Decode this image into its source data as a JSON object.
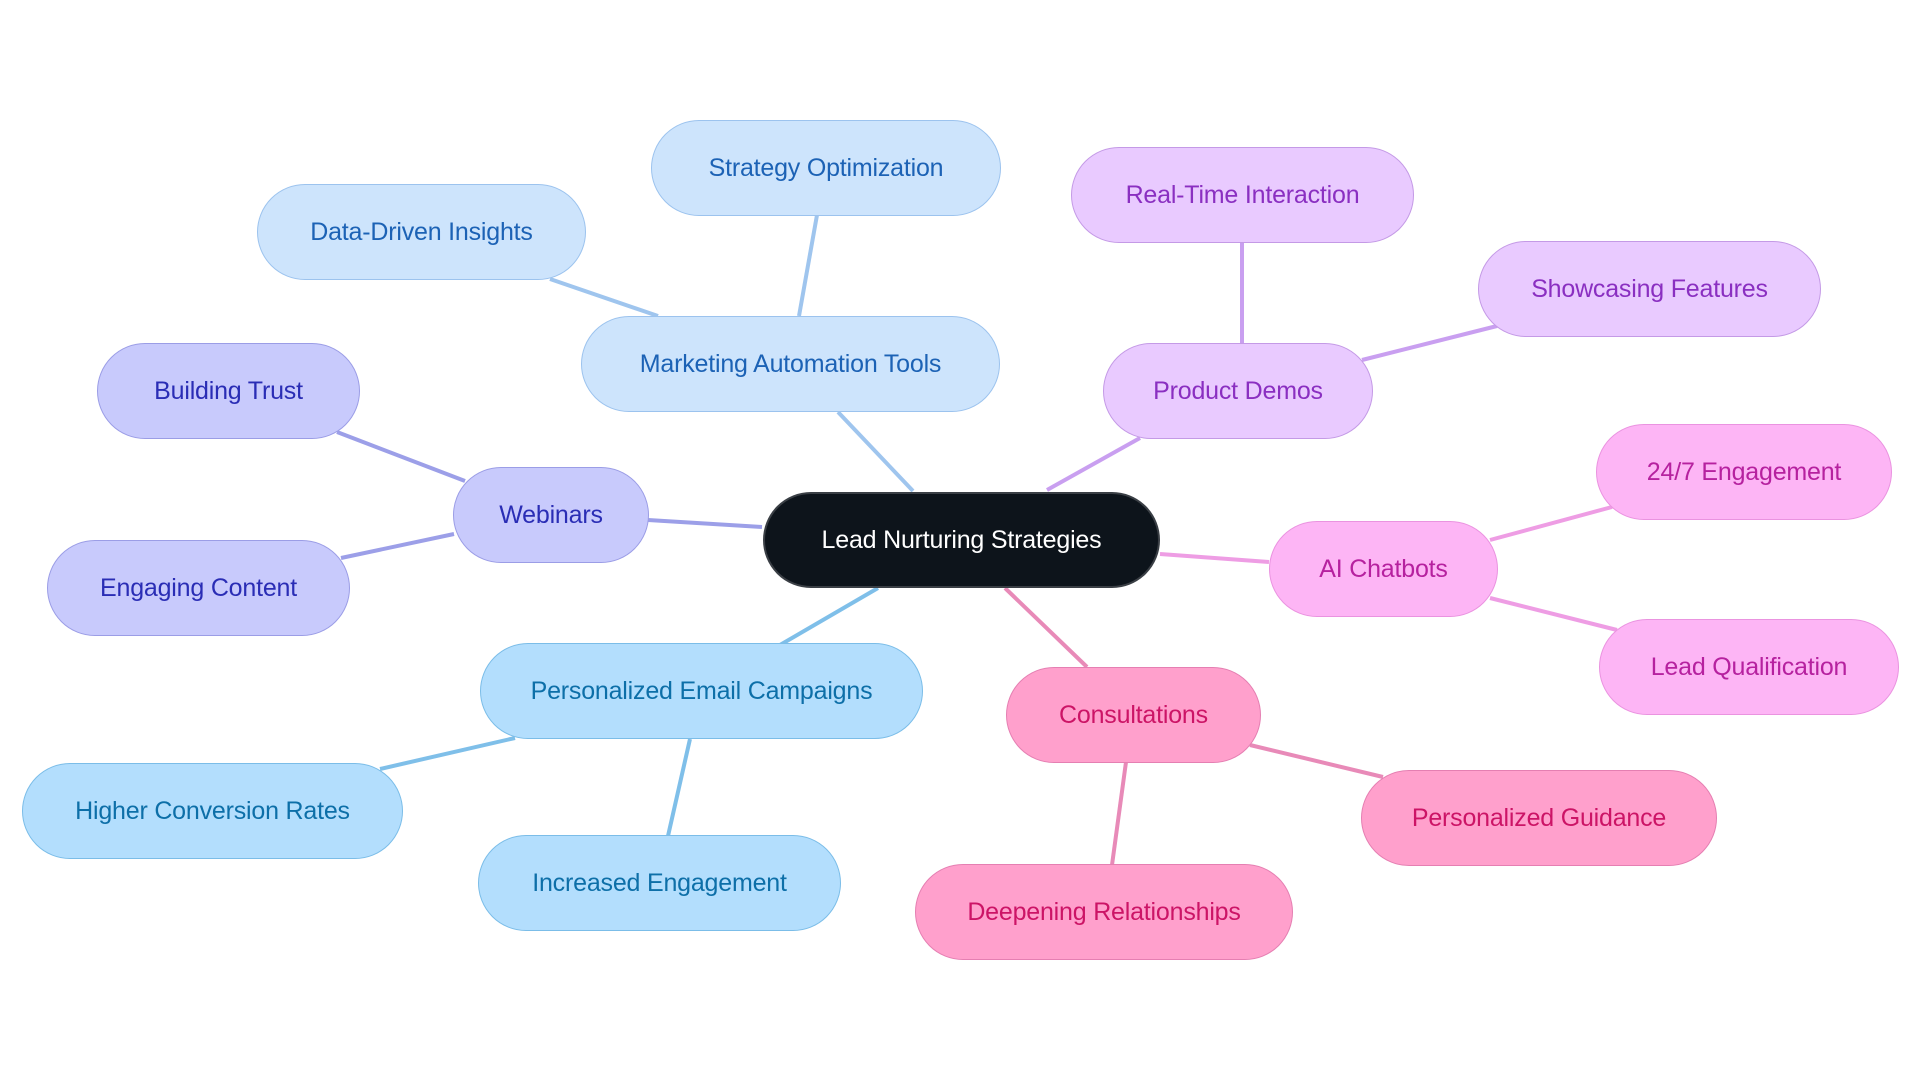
{
  "diagram": {
    "type": "mindmap",
    "root": {
      "id": "root",
      "label": "Lead Nurturing Strategies",
      "color": "#0d141b"
    },
    "branches": [
      {
        "id": "mat",
        "label": "Marketing Automation Tools",
        "color": "#cde4fc",
        "edge_color": "#9fc5ee",
        "children": [
          {
            "id": "mat-1",
            "label": "Strategy Optimization"
          },
          {
            "id": "mat-2",
            "label": "Data-Driven Insights"
          }
        ]
      },
      {
        "id": "web",
        "label": "Webinars",
        "color": "#c8cafc",
        "edge_color": "#9c9fe8",
        "children": [
          {
            "id": "web-1",
            "label": "Building Trust"
          },
          {
            "id": "web-2",
            "label": "Engaging Content"
          }
        ]
      },
      {
        "id": "pec",
        "label": "Personalized Email Campaigns",
        "color": "#b3defd",
        "edge_color": "#7fbfe9",
        "children": [
          {
            "id": "pec-1",
            "label": "Higher Conversion Rates"
          },
          {
            "id": "pec-2",
            "label": "Increased Engagement"
          }
        ]
      },
      {
        "id": "pd",
        "label": "Product Demos",
        "color": "#e9caff",
        "edge_color": "#c99ff0",
        "children": [
          {
            "id": "pd-1",
            "label": "Real-Time Interaction"
          },
          {
            "id": "pd-2",
            "label": "Showcasing Features"
          }
        ]
      },
      {
        "id": "ai",
        "label": "AI Chatbots",
        "color": "#fdb5f5",
        "edge_color": "#ee9de4",
        "children": [
          {
            "id": "ai-1",
            "label": "24/7 Engagement"
          },
          {
            "id": "ai-2",
            "label": "Lead Qualification"
          }
        ]
      },
      {
        "id": "con",
        "label": "Consultations",
        "color": "#ffa0cc",
        "edge_color": "#e88ab8",
        "children": [
          {
            "id": "con-1",
            "label": "Personalized Guidance"
          },
          {
            "id": "con-2",
            "label": "Deepening Relationships"
          }
        ]
      }
    ]
  }
}
